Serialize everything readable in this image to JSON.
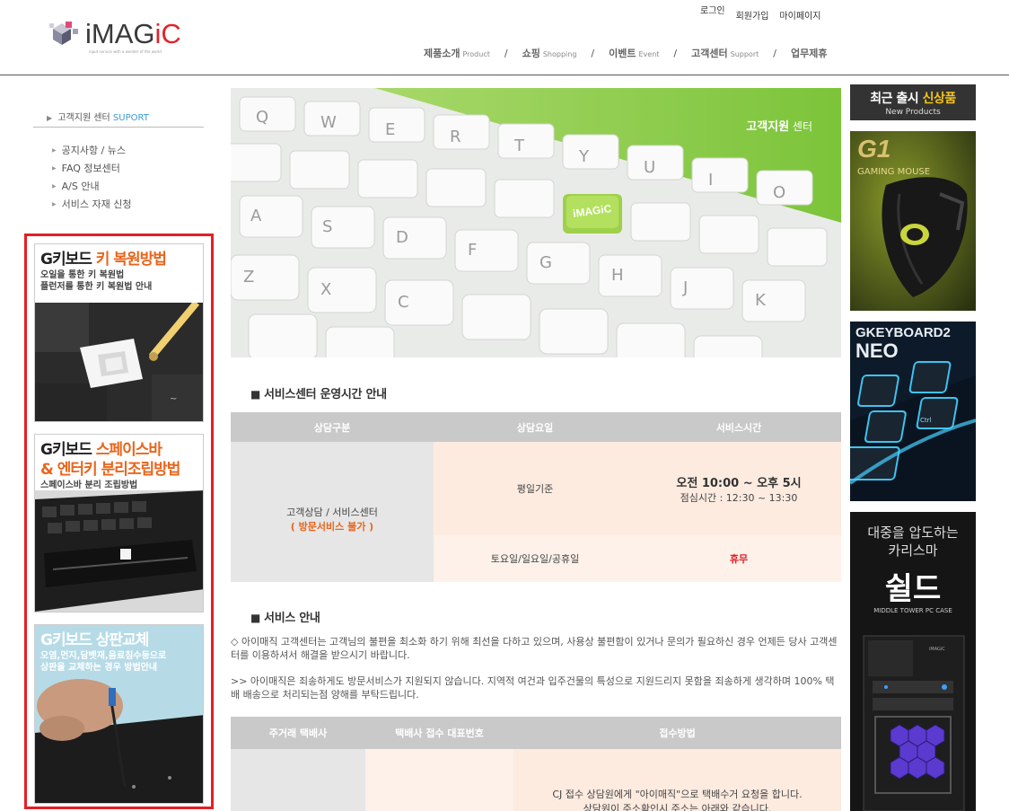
{
  "header": {
    "logo_text_1": "iMAG",
    "logo_text_2": "iC",
    "logo_sub": "input service with a wonder of the world",
    "util": [
      "로그인",
      "회원가입",
      "마이페이지"
    ],
    "gnb": [
      {
        "ko": "제품소개",
        "en": "Product"
      },
      {
        "ko": "쇼핑",
        "en": "Shopping"
      },
      {
        "ko": "이벤트",
        "en": "Event"
      },
      {
        "ko": "고객센터",
        "en": "Support"
      },
      {
        "ko": "업무제휴",
        "en": ""
      }
    ],
    "sep": "/"
  },
  "lnb": {
    "title_ko": "고객지원 센터",
    "title_en": "SUPORT",
    "items": [
      "공지사항 / 뉴스",
      "FAQ 정보센터",
      "A/S 안내",
      "서비스 자재 신청"
    ]
  },
  "guides": [
    {
      "title_a": "G키보드 ",
      "title_b": "키 복원방법",
      "line1": "오일을 통한 키 복원법",
      "line2": "플런저를 통한 키 복원법 안내"
    },
    {
      "title_a": "G키보드 ",
      "title_b": "스페이스바",
      "title_c": "& 엔터키 분리조립방법",
      "line1": "스페이스바 분리 조립방법"
    },
    {
      "title_a": "G키보드 상판교체",
      "line1": "오염,먼지,담뱃재,음료침수등으로",
      "line2": "상판을 교체하는 경우 방법안내"
    }
  ],
  "banner": {
    "title": "고객지원",
    "title_small": " 센터",
    "key_logo": "iMAGiC"
  },
  "section1": {
    "title": "서비스센터 운영시간 안내"
  },
  "hours_table": {
    "headers": [
      "상담구분",
      "상담요일",
      "서비스시간"
    ],
    "category_line1": "고객상담 / 서비스센터",
    "category_line2": "( 방문서비스 불가 )",
    "weekday_label": "평일기준",
    "weekday_time": "오전 10:00 ~ 오후 5시",
    "lunch_time": "점심시간 : 12:30 ~ 13:30",
    "holiday_label": "토요일/일요일/공휴일",
    "holiday_value": "휴무"
  },
  "section2": {
    "title": "서비스 안내",
    "para1": "◇ 아이매직 고객센터는 고객님의 불편을 최소화 하기 위해 최선을 다하고 있으며, 사용상 불편함이 있거나 문의가 필요하신 경우 언제든 당사 고객센터를 이용하셔서 해결을 받으시기 바랍니다.",
    "para2": ">> 아이매직은 죄송하게도 방문서비스가 지원되지 않습니다. 지역적 여건과 입주건물의 특성으로 지원드리지 못함을 죄송하게 생각하며 100% 택배 배송으로 처리되는점 양해를 부탁드립니다."
  },
  "delivery_table": {
    "headers": [
      "주거래 택배사",
      "택배사 접수 대표번호",
      "접수방법"
    ],
    "method_line1": "CJ 접수 상담원에게 \"아이매직\"으로 택배수거 요청을 합니다.",
    "method_line2": "상담원이 주소확인시 주소는 아래와 같습니다."
  },
  "right_banners": {
    "new_title_a": "최근 출시 ",
    "new_title_b": "신상품",
    "new_sub": "New Products",
    "mouse_logo": "G1",
    "mouse_label": "GAMING MOUSE",
    "kb_title1": "GKEYBOARD2",
    "kb_title2": "NEO",
    "kb_key": "Ctrl",
    "case_line1": "대중을 압도하는",
    "case_line2": "카리스마",
    "case_name": "쉴드",
    "case_sub": "MIDDLE TOWER PC CASE",
    "case_brand": "iMAGiC"
  }
}
